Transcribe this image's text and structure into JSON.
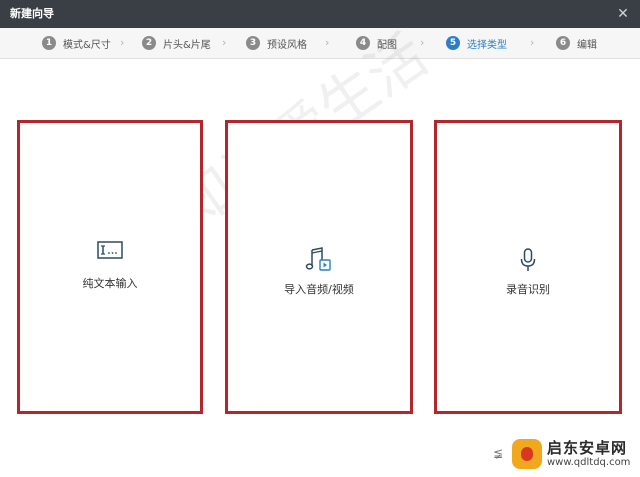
{
  "window": {
    "title": "新建向导",
    "close_glyph": "✕"
  },
  "steps": [
    {
      "num": "1",
      "label": "模式&尺寸",
      "active": false
    },
    {
      "num": "2",
      "label": "片头&片尾",
      "active": false
    },
    {
      "num": "3",
      "label": "预设风格",
      "active": false
    },
    {
      "num": "4",
      "label": "配图",
      "active": false
    },
    {
      "num": "5",
      "label": "选择类型",
      "active": true
    },
    {
      "num": "6",
      "label": "编辑",
      "active": false
    }
  ],
  "step_separator": "›",
  "options": [
    {
      "label": "纯文本输入",
      "icon": "text-cursor-icon"
    },
    {
      "label": "导入音频/视频",
      "icon": "music-video-icon"
    },
    {
      "label": "录音识别",
      "icon": "microphone-icon"
    }
  ],
  "watermark": {
    "text": "学知识爱生活"
  },
  "brand": {
    "name": "启东安卓网",
    "url": "www.qdltdq.com",
    "small_mark": "≨"
  },
  "colors": {
    "titlebar": "#3a3f46",
    "active_step": "#2a7fc6",
    "card_border": "#b3262b"
  }
}
